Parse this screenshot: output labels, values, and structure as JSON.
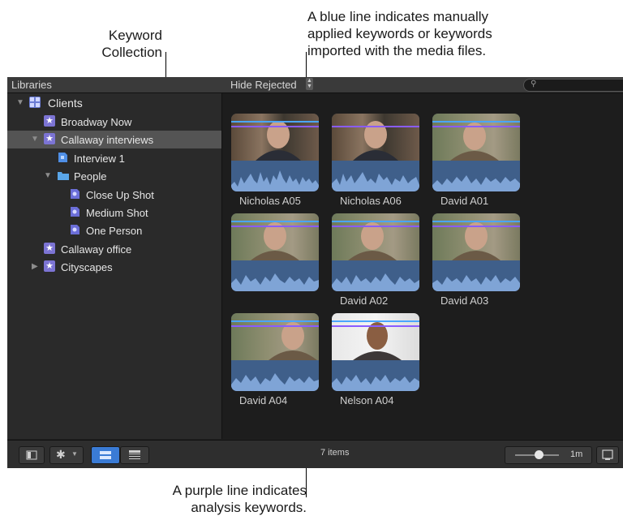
{
  "callouts": {
    "keyword_collection": [
      "Keyword",
      "Collection"
    ],
    "blue_line": [
      "A blue line indicates manually",
      "applied keywords or keywords",
      "imported with the media files."
    ],
    "purple_line": [
      "A purple line indicates",
      "analysis keywords."
    ]
  },
  "header": {
    "libraries": "Libraries",
    "hide_rejected": "Hide Rejected",
    "search_placeholder": ""
  },
  "sidebar": {
    "items": [
      {
        "label": "Clients",
        "icon": "library-icon"
      },
      {
        "label": "Broadway Now",
        "icon": "event-star-icon"
      },
      {
        "label": "Callaway interviews",
        "icon": "event-star-icon"
      },
      {
        "label": "Interview 1",
        "icon": "keyword-collection-icon"
      },
      {
        "label": "People",
        "icon": "folder-icon"
      },
      {
        "label": "Close Up Shot",
        "icon": "keyword-collection-icon"
      },
      {
        "label": "Medium Shot",
        "icon": "keyword-collection-icon"
      },
      {
        "label": "One Person",
        "icon": "keyword-collection-icon"
      },
      {
        "label": "Callaway office",
        "icon": "event-star-icon"
      },
      {
        "label": "Cityscapes",
        "icon": "event-star-icon"
      }
    ]
  },
  "clips": [
    {
      "name": "Nicholas A05"
    },
    {
      "name": "Nicholas A06"
    },
    {
      "name": "David A01"
    },
    {
      "name": ""
    },
    {
      "name": "David A02"
    },
    {
      "name": "David A03"
    },
    {
      "name": "David A04"
    },
    {
      "name": "Nelson A04"
    }
  ],
  "footer": {
    "items_count": "7 items",
    "duration": "1m"
  },
  "colors": {
    "blue_keyword_line": "#4aa6ff",
    "purple_keyword_line": "#8a5cff",
    "selection": "#545454",
    "accent": "#3a7bd5"
  }
}
